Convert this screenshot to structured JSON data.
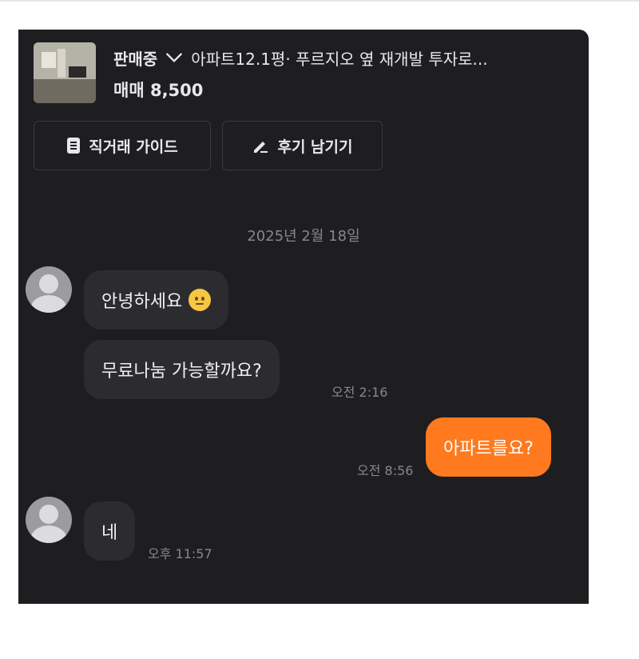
{
  "listing": {
    "status": "판매중",
    "title": "아파트12.1평· 푸르지오 옆 재개발 투자로...",
    "price": "매매 8,500"
  },
  "buttons": {
    "guide_label": "직거래 가이드",
    "review_label": "후기 남기기"
  },
  "chat": {
    "date": "2025년 2월 18일",
    "messages": [
      {
        "sender": "other",
        "text": "안녕하세요",
        "time": ""
      },
      {
        "sender": "other",
        "text": "무료나눔 가능할까요?",
        "time": "오전 2:16"
      },
      {
        "sender": "me",
        "text": "아파트를요?",
        "time": "오전 8:56"
      },
      {
        "sender": "other",
        "text": "네",
        "time": "오후 11:57"
      }
    ]
  },
  "colors": {
    "background": "#1e1e21",
    "bubble_other": "#2c2c30",
    "bubble_mine": "#ff7a1f"
  },
  "icons": [
    "chevron-down-icon",
    "document-icon",
    "pencil-icon",
    "avatar-icon",
    "smiley-emoji-icon"
  ]
}
